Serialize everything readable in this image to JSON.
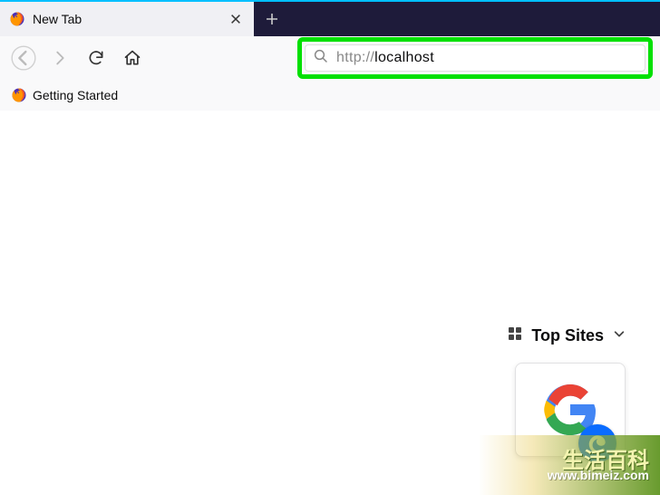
{
  "tab": {
    "label": "New Tab"
  },
  "url": {
    "prefix": "http://",
    "host": "localhost"
  },
  "bookmarks": {
    "getting_started": "Getting Started"
  },
  "newtab": {
    "top_sites_label": "Top Sites"
  },
  "watermark": {
    "text": "生活百科",
    "url": "www.bimeiz.com"
  },
  "colors": {
    "highlight": "#00e000",
    "tab_strip": "#1e1b3a"
  }
}
